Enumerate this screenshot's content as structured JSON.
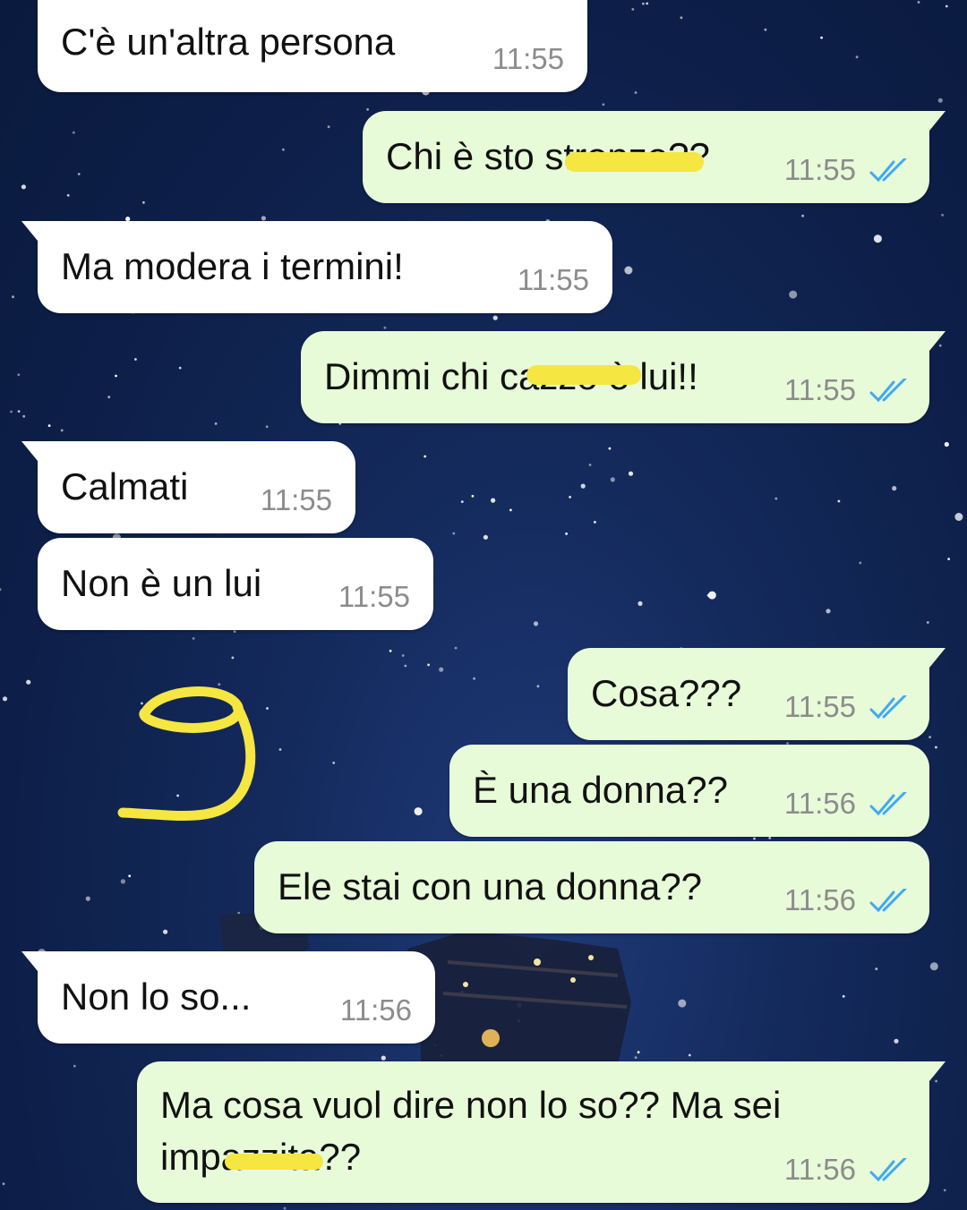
{
  "colors": {
    "background": "#0d1f48",
    "incoming_bubble": "#ffffff",
    "outgoing_bubble": "#e8fbd8",
    "read_ticks": "#3fa9f5",
    "highlighter": "#f5e642"
  },
  "messages": [
    {
      "direction": "in",
      "text": "C'è un'altra persona",
      "time": "11:55"
    },
    {
      "direction": "out",
      "text": "Chi è sto stronzo??",
      "time": "11:55",
      "status": "read"
    },
    {
      "direction": "in",
      "text": "Ma modera i termini!",
      "time": "11:55"
    },
    {
      "direction": "out",
      "text": "Dimmi chi cazzo è lui!!",
      "time": "11:55",
      "status": "read"
    },
    {
      "direction": "in",
      "text": "Calmati",
      "time": "11:55"
    },
    {
      "direction": "in",
      "text": "Non è un lui",
      "time": "11:55"
    },
    {
      "direction": "out",
      "text": "Cosa???",
      "time": "11:55",
      "status": "read"
    },
    {
      "direction": "out",
      "text": "È una donna??",
      "time": "11:56",
      "status": "read"
    },
    {
      "direction": "out",
      "text": "Ele stai con una donna??",
      "time": "11:56",
      "status": "read"
    },
    {
      "direction": "in",
      "text": "Non lo so...",
      "time": "11:56"
    },
    {
      "direction": "out",
      "text": "Ma cosa vuol dire non lo so?? Ma sei impazzita??",
      "time": "11:56",
      "status": "read"
    }
  ],
  "annotation": {
    "icon": "handwritten-number-9"
  }
}
